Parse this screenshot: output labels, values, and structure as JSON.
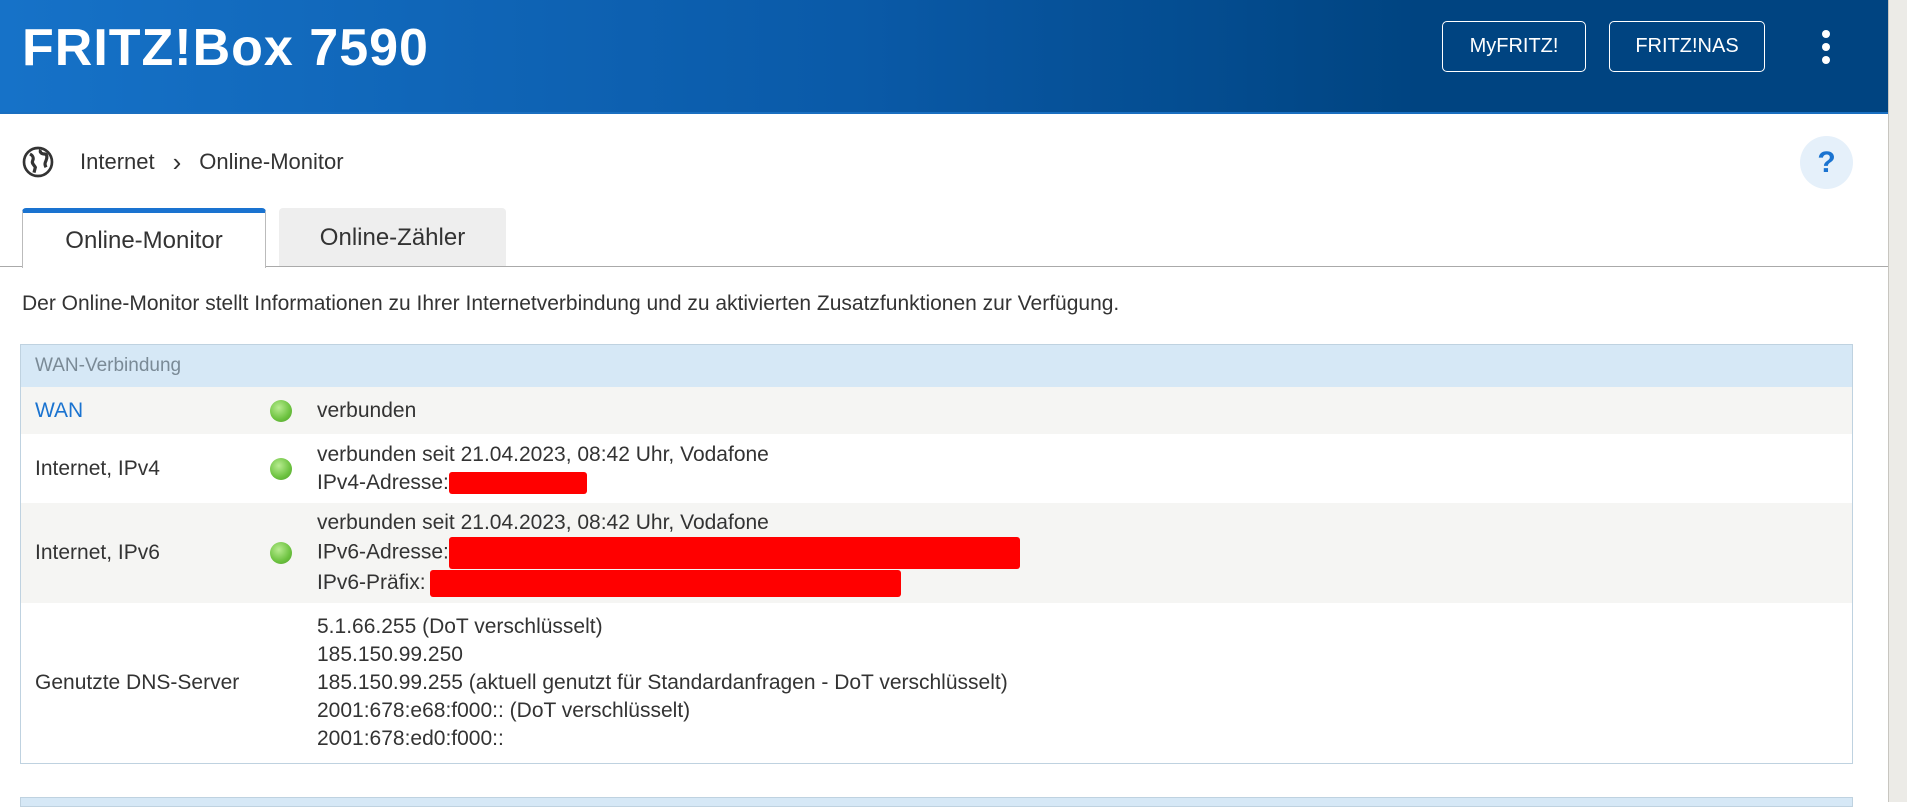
{
  "header": {
    "title": "FRITZ!Box 7590",
    "myfritz": "MyFRITZ!",
    "fritznas": "FRITZ!NAS"
  },
  "breadcrumb": {
    "root": "Internet",
    "separator": "›",
    "current": "Online-Monitor"
  },
  "help": "?",
  "tabs": [
    {
      "label": "Online-Monitor",
      "active": true
    },
    {
      "label": "Online-Zähler",
      "active": false
    }
  ],
  "description": "Der Online-Monitor stellt Informationen zu Ihrer Internetverbindung und zu aktivierten Zusatzfunktionen zur Verfügung.",
  "table": {
    "title": "WAN-Verbindung",
    "rows": [
      {
        "label": "WAN",
        "status": "green",
        "lines": [
          "verbunden"
        ]
      },
      {
        "label": "Internet, IPv4",
        "status": "green",
        "lines": [
          "verbunden seit 21.04.2023, 08:42 Uhr, Vodafone",
          "IPv4-Adresse:"
        ]
      },
      {
        "label": "Internet, IPv6",
        "status": "green",
        "lines": [
          "verbunden seit 21.04.2023, 08:42 Uhr, Vodafone",
          "IPv6-Adresse:",
          "IPv6-Präfix:"
        ]
      },
      {
        "label": "Genutzte DNS-Server",
        "lines": [
          "5.1.66.255 (DoT verschlüsselt)",
          "185.150.99.250",
          "185.150.99.255 (aktuell genutzt für Standardanfragen - DoT verschlüsselt)",
          "2001:678:e68:f000:: (DoT verschlüsselt)",
          "2001:678:ed0:f000::"
        ]
      }
    ]
  },
  "colors": {
    "accent": "#1a73d0",
    "header_dark": "#004481",
    "status_ok": "#6cc23f",
    "redaction": "#ff0000"
  }
}
